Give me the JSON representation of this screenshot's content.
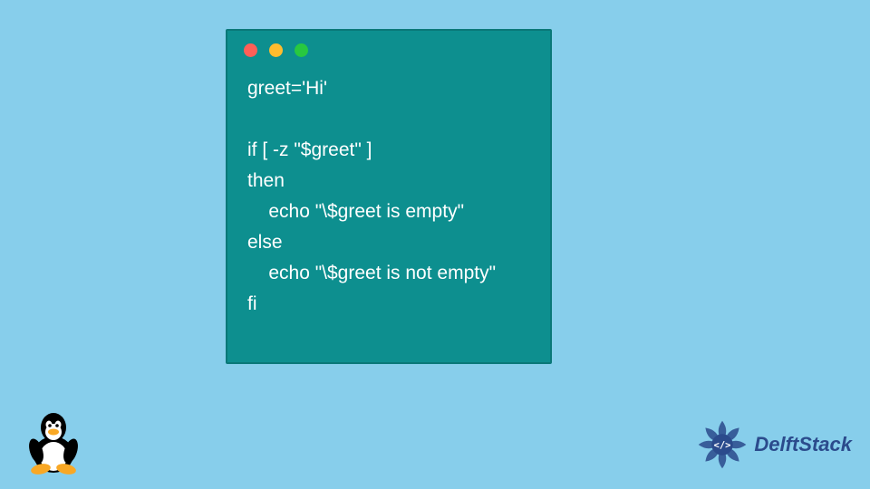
{
  "code": {
    "line1": "greet='Hi'",
    "line2": "",
    "line3": "if [ -z \"$greet\" ]",
    "line4": "then",
    "line5": "    echo \"\\$greet is empty\"",
    "line6": "else",
    "line7": "    echo \"\\$greet is not empty\"",
    "line8": "fi"
  },
  "brand": {
    "name": "DelftStack"
  },
  "icons": {
    "penguin": "penguin-icon",
    "mandala": "mandala-icon"
  },
  "colors": {
    "background": "#87ceeb",
    "window": "#0d8f8f",
    "text": "#ffffff",
    "brand": "#2b4b8c"
  }
}
